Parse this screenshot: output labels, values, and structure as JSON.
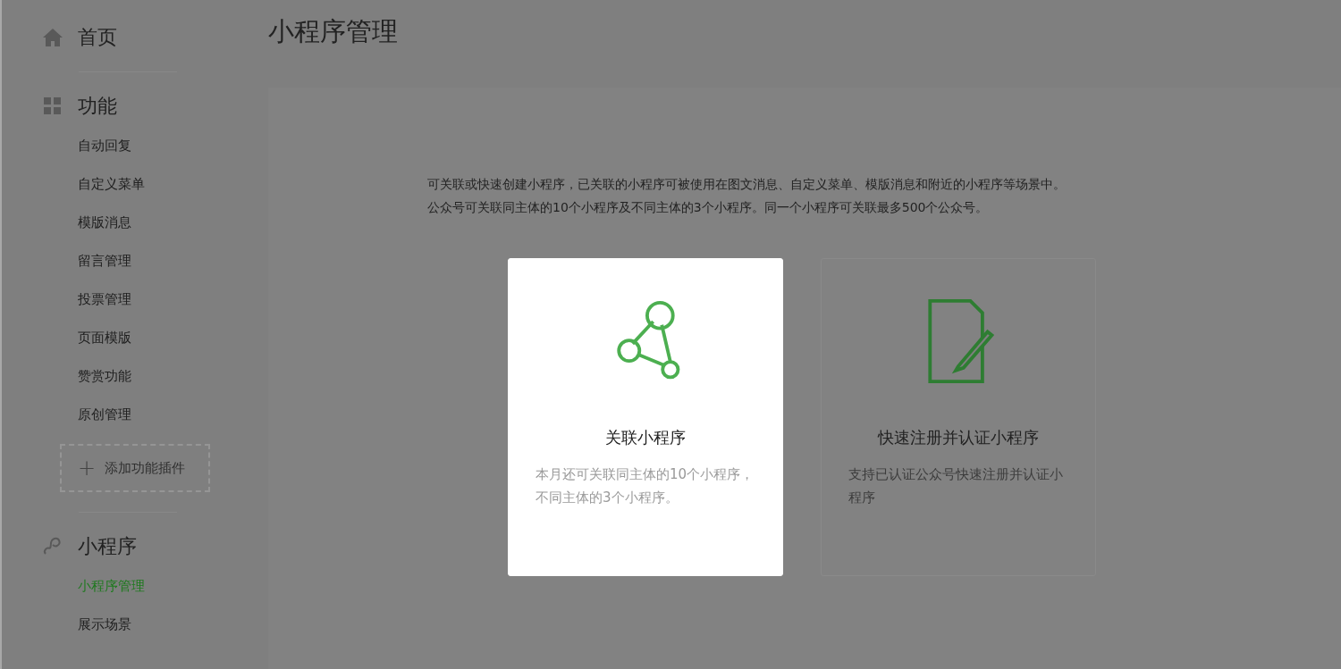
{
  "sidebar": {
    "sections": [
      {
        "kind": "home",
        "title": "首页"
      },
      {
        "kind": "grid",
        "title": "功能",
        "items": [
          {
            "label": "自动回复",
            "selected": false
          },
          {
            "label": "自定义菜单",
            "selected": false
          },
          {
            "label": "模版消息",
            "selected": false
          },
          {
            "label": "留言管理",
            "selected": false
          },
          {
            "label": "投票管理",
            "selected": false
          },
          {
            "label": "页面模版",
            "selected": false
          },
          {
            "label": "赞赏功能",
            "selected": false
          },
          {
            "label": "原创管理",
            "selected": false
          }
        ],
        "add_button": {
          "icon": "+",
          "label": "添加功能插件"
        }
      },
      {
        "kind": "link",
        "title": "小程序",
        "items": [
          {
            "label": "小程序管理",
            "selected": true
          },
          {
            "label": "展示场景",
            "selected": false
          }
        ]
      }
    ]
  },
  "page_title": "小程序管理",
  "intro": [
    "可关联或快速创建小程序，已关联的小程序可被使用在图文消息、自定义菜单、模版消息和附近的小程序等场景中。",
    "公众号可关联同主体的10个小程序及不同主体的3个小程序。同一个小程序可关联最多500个公众号。"
  ],
  "cards": [
    {
      "kind": "link",
      "highlighted": true,
      "title": "关联小程序",
      "description": "本月还可关联同主体的10个小程序，不同主体的3个小程序。"
    },
    {
      "kind": "register",
      "highlighted": false,
      "title": "快速注册并认证小程序",
      "description": "支持已认证公众号快速注册并认证小程序"
    }
  ]
}
